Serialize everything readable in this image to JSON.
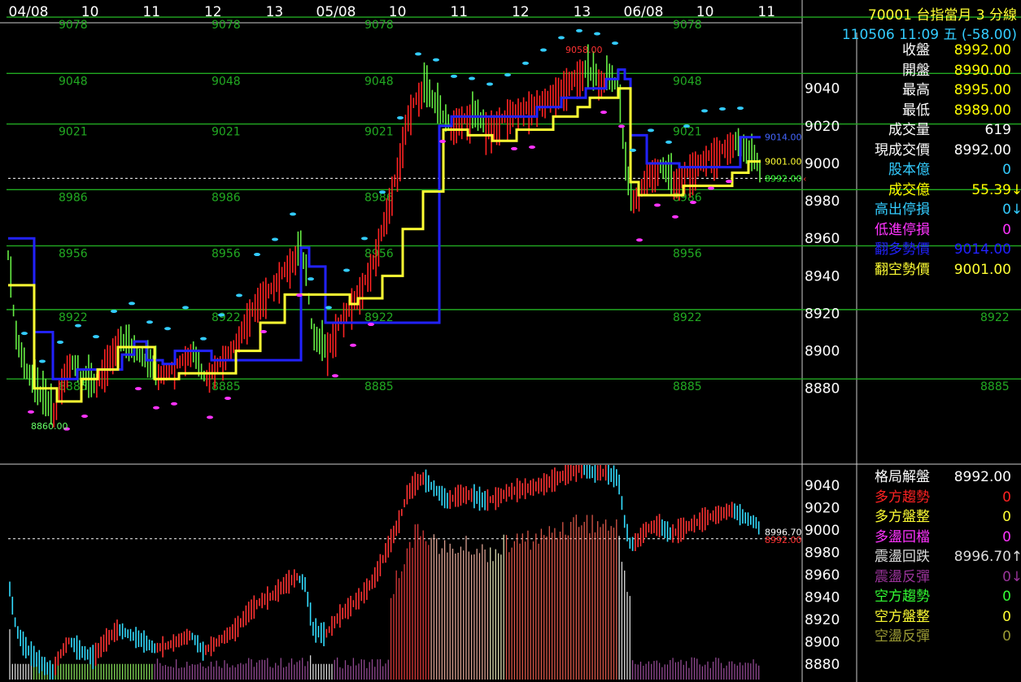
{
  "header": {
    "title": "70001  台指當月 3 分線",
    "subtitle": "110506 11:09 五  (-58.00)"
  },
  "info_panel": [
    {
      "label": "收盤",
      "value": "8992.00",
      "label_color": "#ffffff",
      "value_color": "#ffff00"
    },
    {
      "label": "開盤",
      "value": "8990.00",
      "label_color": "#ffffff",
      "value_color": "#ffff00"
    },
    {
      "label": "最高",
      "value": "8995.00",
      "label_color": "#ffffff",
      "value_color": "#ffff00"
    },
    {
      "label": "最低",
      "value": "8989.00",
      "label_color": "#ffffff",
      "value_color": "#ffff00"
    },
    {
      "label": "成交量",
      "value": "619",
      "label_color": "#ffffff",
      "value_color": "#ffffff"
    },
    {
      "label": "現成交價",
      "value": "8992.00",
      "label_color": "#ffffff",
      "value_color": "#ffffff"
    },
    {
      "label": "股本億",
      "value": "0",
      "label_color": "#33ccff",
      "value_color": "#33ccff"
    },
    {
      "label": "成交億",
      "value": "55.39",
      "label_color": "#ffff00",
      "value_color": "#ffff00",
      "arrow": "↓",
      "arrow_color": "#ffff00"
    },
    {
      "label": "高出停損",
      "value": "0",
      "label_color": "#33ccff",
      "value_color": "#33ccff",
      "arrow": "↓",
      "arrow_color": "#33ccff"
    },
    {
      "label": "低進停損",
      "value": "0",
      "label_color": "#ff33ff",
      "value_color": "#ff33ff"
    },
    {
      "label": "翻多勢價",
      "value": "9014.00",
      "label_color": "#2222ff",
      "value_color": "#2222ff"
    },
    {
      "label": "翻空勢價",
      "value": "9001.00",
      "label_color": "#ffff33",
      "value_color": "#ffff33"
    }
  ],
  "pattern_panel": [
    {
      "label": "格局解盤",
      "value": "8992.00",
      "label_color": "#ffffff",
      "value_color": "#ffffff"
    },
    {
      "label": "多方趨勢",
      "value": "0",
      "label_color": "#ff2222",
      "value_color": "#ff2222"
    },
    {
      "label": "多方盤整",
      "value": "0",
      "label_color": "#ffff33",
      "value_color": "#ffff33"
    },
    {
      "label": "多盪回檔",
      "value": "0",
      "label_color": "#ff33ff",
      "value_color": "#ff33ff"
    },
    {
      "label": "震盪回跌",
      "value": "8996.70",
      "label_color": "#dddddd",
      "value_color": "#dddddd",
      "arrow": "↑",
      "arrow_color": "#dddddd"
    },
    {
      "label": "震盪反彈",
      "value": "0",
      "label_color": "#993399",
      "value_color": "#993399",
      "arrow": "↓",
      "arrow_color": "#993399"
    },
    {
      "label": "空方趨勢",
      "value": "0",
      "label_color": "#33ff33",
      "value_color": "#33ff33"
    },
    {
      "label": "空方盤整",
      "value": "0",
      "label_color": "#ffff33",
      "value_color": "#ffff33"
    },
    {
      "label": "空盪反彈",
      "value": "0",
      "label_color": "#999933",
      "value_color": "#999933"
    }
  ],
  "chart_data": [
    {
      "type": "candlestick",
      "x_ticks": [
        "04/08",
        "10",
        "11",
        "12",
        "13",
        "05/08",
        "10",
        "11",
        "12",
        "13",
        "06/08",
        "10",
        "11"
      ],
      "y_ticks": [
        9040,
        9020,
        9000,
        8980,
        8960,
        8940,
        8920,
        8900,
        8880
      ],
      "ylim": [
        8840,
        9075
      ],
      "levels": [
        9078,
        9048,
        9021,
        8986,
        8956,
        8922,
        8885
      ],
      "annotations": [
        {
          "text": "9058.00",
          "value": 9058
        },
        {
          "text": "8860.00",
          "value": 8860
        },
        {
          "text": "9014.00",
          "value": 9014
        },
        {
          "text": "9001.00",
          "value": 9001
        },
        {
          "text": "8992.00",
          "value": 8992
        }
      ],
      "current_price": 8992,
      "trail_up_value": 9014,
      "trail_down_value": 9001,
      "colors": {
        "up": "#ff2222",
        "down": "#66ee44",
        "blue_line": "#2222ff",
        "yellow_line": "#ffff33",
        "level": "#22aa22"
      }
    },
    {
      "type": "candlestick",
      "y_ticks": [
        9040,
        9020,
        9000,
        8980,
        8960,
        8940,
        8920,
        8900,
        8880
      ],
      "ylim": [
        8866,
        9058
      ],
      "annotations": [
        {
          "text": "8996.70",
          "value": 8996.7
        },
        {
          "text": "8992.00",
          "value": 8992
        }
      ]
    }
  ]
}
